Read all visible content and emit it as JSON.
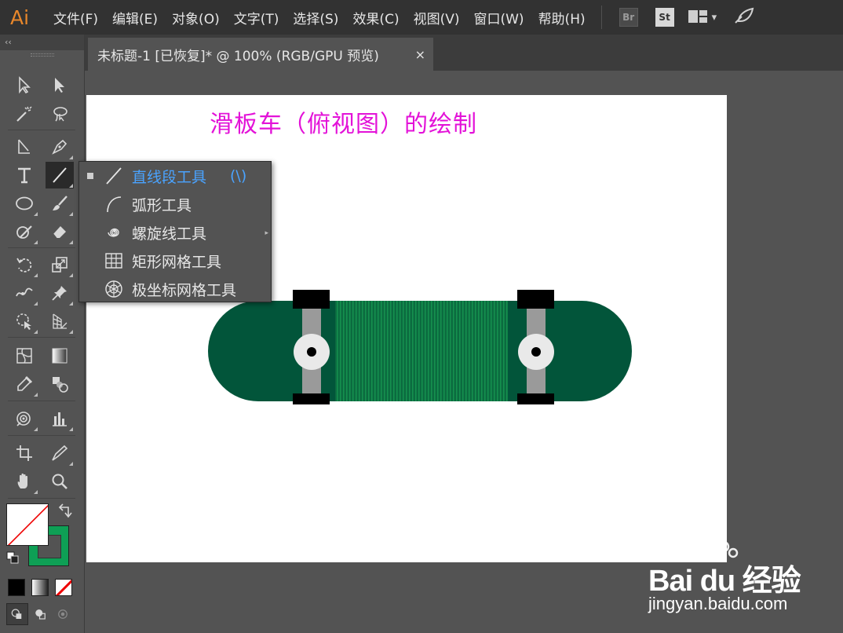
{
  "app": {
    "logo_text": "Ai"
  },
  "menu": {
    "items": [
      "文件(F)",
      "编辑(E)",
      "对象(O)",
      "文字(T)",
      "选择(S)",
      "效果(C)",
      "视图(V)",
      "窗口(W)",
      "帮助(H)"
    ],
    "bridge_label": "Br",
    "stock_label": "St"
  },
  "toolbar": {
    "collapse_label": "‹‹"
  },
  "document": {
    "tab_title": "未标题-1 [已恢复]* @ 100% (RGB/GPU 预览)",
    "close_glyph": "×",
    "artboard_title": "滑板车（俯视图）的绘制"
  },
  "flyout": {
    "items": [
      {
        "label": "直线段工具",
        "shortcut": "(\\)",
        "selected": true,
        "icon": "line-segment-icon"
      },
      {
        "label": "弧形工具",
        "shortcut": "",
        "selected": false,
        "icon": "arc-icon"
      },
      {
        "label": "螺旋线工具",
        "shortcut": "",
        "selected": false,
        "icon": "spiral-icon"
      },
      {
        "label": "矩形网格工具",
        "shortcut": "",
        "selected": false,
        "icon": "rectangular-grid-icon"
      },
      {
        "label": "极坐标网格工具",
        "shortcut": "",
        "selected": false,
        "icon": "polar-grid-icon"
      }
    ]
  },
  "colors": {
    "menubar_bg": "#323232",
    "panel_bg": "#535353",
    "title_magenta": "#e312d8",
    "deck_green": "#02553a",
    "grip_green": "#0b7a45",
    "truck_gray": "#9a9a9a",
    "wheel_white": "#e9e9e9",
    "stroke_green": "#0e9f55",
    "selection_blue": "#4aa3ff"
  },
  "watermark": {
    "brand": "Bai du 经验",
    "url": "jingyan.baidu.com"
  }
}
